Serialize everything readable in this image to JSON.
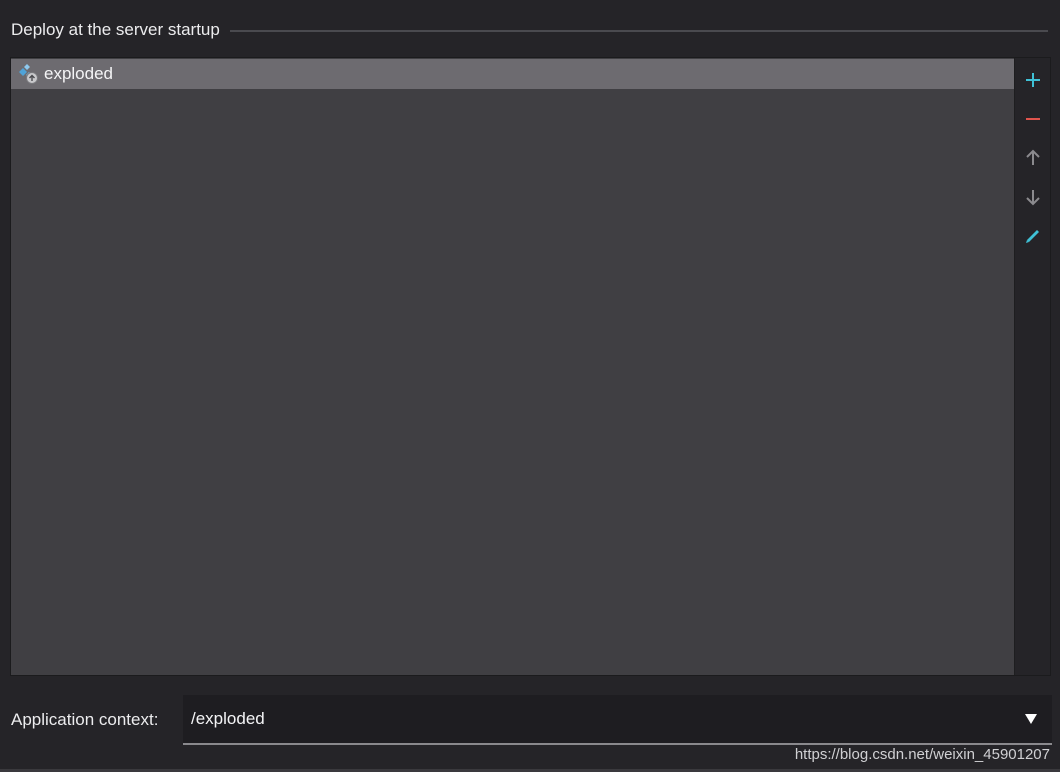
{
  "section": {
    "title": "Deploy at the server startup"
  },
  "artifacts": {
    "items": [
      {
        "label": "exploded",
        "icon": "artifact-exploded-icon",
        "selected": true
      }
    ]
  },
  "toolbar": {
    "add_icon": "plus-icon",
    "remove_icon": "minus-icon",
    "move_up_icon": "arrow-up-icon",
    "move_down_icon": "arrow-down-icon",
    "edit_icon": "pencil-icon"
  },
  "context": {
    "label": "Application context:",
    "value": "/exploded"
  },
  "watermark": "https://blog.csdn.net/weixin_45901207",
  "colors": {
    "accent": "#3fc1d6",
    "remove": "#e0544d",
    "selection": "#6d6b70",
    "list_bg": "#403f43"
  }
}
